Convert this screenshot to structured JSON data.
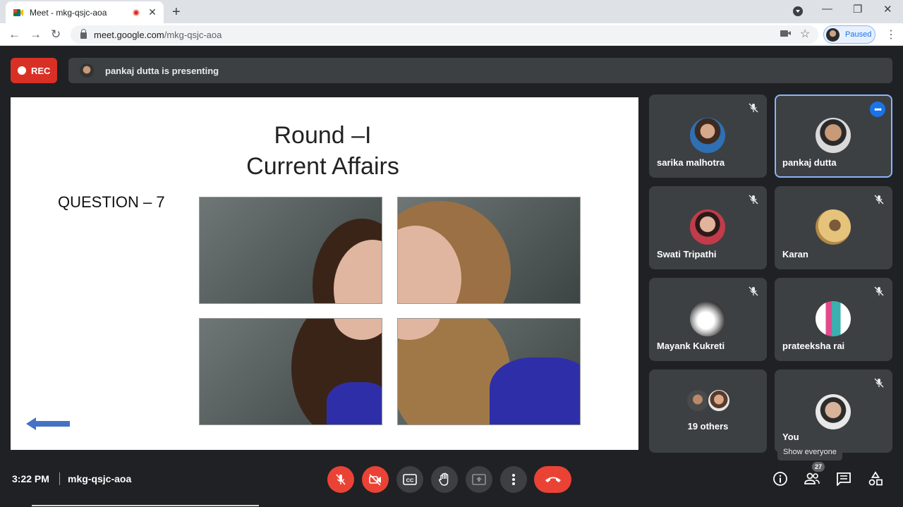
{
  "browser": {
    "tab_title": "Meet - mkg-qsjc-aoa",
    "url_host": "meet.google.com",
    "url_path": "/mkg-qsjc-aoa",
    "profile_status": "Paused"
  },
  "meet": {
    "rec_label": "REC",
    "presenting_text": "pankaj dutta is presenting"
  },
  "slide": {
    "title_line1": "Round –I",
    "title_line2": "Current Affairs",
    "question": "QUESTION – 7"
  },
  "participants": [
    {
      "name": "sarika malhotra",
      "muted": true,
      "avatar": "woman-in-blue-saree"
    },
    {
      "name": "pankaj dutta",
      "muted": false,
      "active": true,
      "avatar": "man-with-glasses"
    },
    {
      "name": "Swati Tripathi",
      "muted": true,
      "avatar": "woman-red"
    },
    {
      "name": "Karan",
      "muted": true,
      "avatar": "cartoon"
    },
    {
      "name": "Mayank Kukreti",
      "muted": true,
      "avatar": "bright-light"
    },
    {
      "name": "prateeksha rai",
      "muted": true,
      "avatar": "woman-pink"
    },
    {
      "name": "You",
      "muted": true,
      "avatar": "man-sunglasses"
    }
  ],
  "others": {
    "label": "19 others"
  },
  "tooltip": "Show everyone",
  "bottom": {
    "time": "3:22 PM",
    "meeting_code": "mkg-qsjc-aoa",
    "people_count": "27"
  },
  "colors": {
    "meet_bg": "#202124",
    "tile_bg": "#3c4043",
    "danger": "#ea4335",
    "accent": "#1a73e8"
  }
}
